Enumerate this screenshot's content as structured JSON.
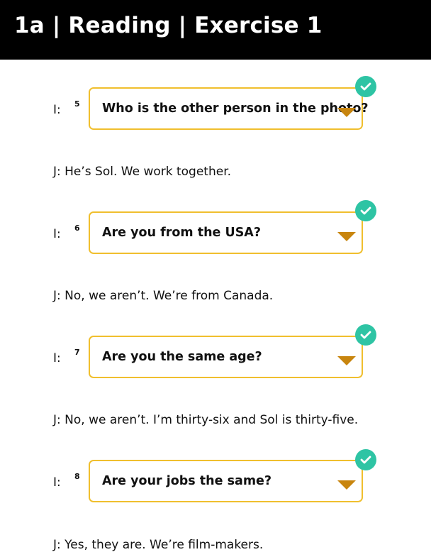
{
  "header": {
    "title": "1a | Reading | Exercise 1"
  },
  "questions": [
    {
      "speaker": "I:",
      "number": "5",
      "selected": "Who is the other person in the photo?",
      "answer": "J: He’s Sol. We work together."
    },
    {
      "speaker": "I:",
      "number": "6",
      "selected": "Are you from the USA?",
      "answer": "J: No, we aren’t. We’re from Canada."
    },
    {
      "speaker": "I:",
      "number": "7",
      "selected": "Are you the same age?",
      "answer": "J: No, we aren’t. I’m thirty-six and Sol is thirty-five."
    },
    {
      "speaker": "I:",
      "number": "8",
      "selected": "Are your jobs the same?",
      "answer": "J: Yes, they are. We’re film-makers."
    }
  ],
  "colors": {
    "header_bg": "#000000",
    "dropdown_border": "#f0bf2e",
    "caret": "#c8850e",
    "check": "#2ec4a4"
  },
  "icons": {
    "check": "check-circle-icon",
    "caret": "caret-down-icon"
  }
}
